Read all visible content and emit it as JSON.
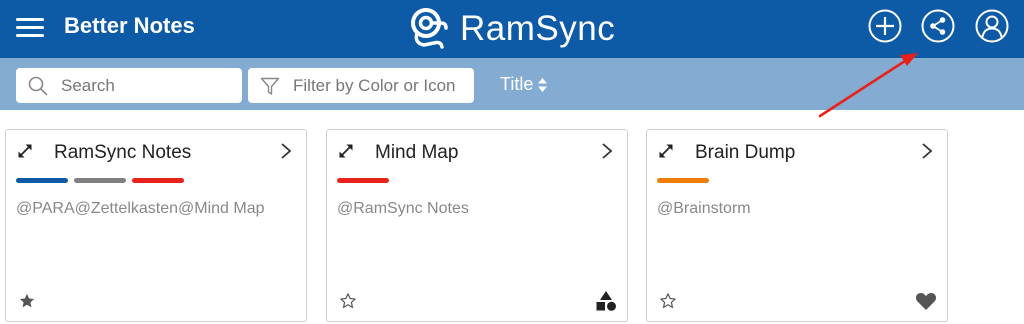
{
  "header": {
    "app_title": "Better Notes",
    "brand": "RamSync",
    "colors": {
      "background": "#0d5aa7",
      "foreground": "#ffffff"
    },
    "icons": [
      "menu-icon",
      "ramsync-logo-icon",
      "add-icon",
      "share-icon",
      "user-icon"
    ]
  },
  "toolbar": {
    "search": {
      "placeholder": "Search",
      "value": ""
    },
    "filter": {
      "placeholder": "Filter by Color or Icon",
      "value": ""
    },
    "sort": {
      "label": "Title",
      "icon": "sort-icon"
    },
    "background": "#84acd2"
  },
  "cards": [
    {
      "title": "RamSync Notes",
      "colors": [
        "#0d5aa7",
        "#808080",
        "#e8221b"
      ],
      "tags": "@PARA@Zettelkasten@Mind Map",
      "starred": true,
      "corner_icon": ""
    },
    {
      "title": "Mind Map",
      "colors": [
        "#e8221b"
      ],
      "tags": "@RamSync Notes",
      "starred": false,
      "corner_icon": "shapes-icon"
    },
    {
      "title": "Brain Dump",
      "colors": [
        "#f07d0a"
      ],
      "tags": "@Brainstorm",
      "starred": false,
      "corner_icon": "heart-icon"
    }
  ],
  "annotation": {
    "arrow_color": "#e8221b"
  }
}
